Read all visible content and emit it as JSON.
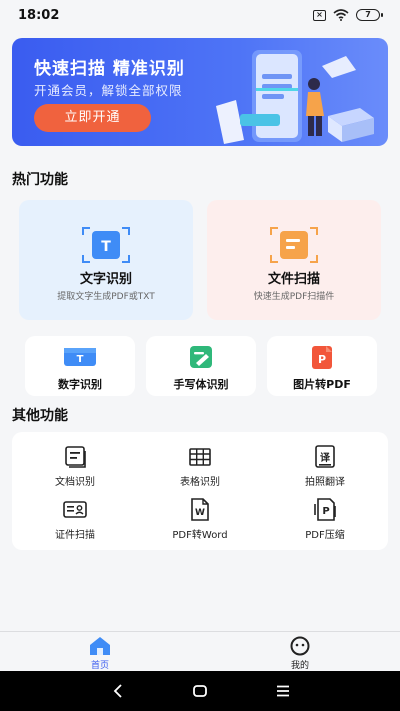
{
  "status_bar": {
    "time": "18:02",
    "battery": "7"
  },
  "banner": {
    "title": "快速扫描  精准识别",
    "subtitle": "开通会员，解锁全部权限",
    "cta_label": "立即开通"
  },
  "hot_section": {
    "title": "热门功能",
    "big_cards": [
      {
        "title": "文字识别",
        "subtitle": "提取文字生成PDF或TXT",
        "icon": "text-recognition-icon",
        "bg": "#e6f1fd"
      },
      {
        "title": "文件扫描",
        "subtitle": "快速生成PDF扫描件",
        "icon": "document-scan-icon",
        "bg": "#fdeeed"
      }
    ],
    "small_cards": [
      {
        "label": "数字识别",
        "icon": "number-recognition-icon"
      },
      {
        "label": "手写体识别",
        "icon": "handwriting-icon"
      },
      {
        "label": "图片转PDF",
        "icon": "image-to-pdf-icon"
      }
    ]
  },
  "other_section": {
    "title": "其他功能",
    "items": [
      {
        "label": "文档识别",
        "icon": "document-icon"
      },
      {
        "label": "表格识别",
        "icon": "table-icon"
      },
      {
        "label": "拍照翻译",
        "icon": "translate-icon"
      },
      {
        "label": "证件扫描",
        "icon": "id-card-icon"
      },
      {
        "label": "PDF转Word",
        "icon": "pdf-to-word-icon"
      },
      {
        "label": "PDF压缩",
        "icon": "pdf-compress-icon"
      }
    ]
  },
  "tabbar": {
    "tabs": [
      {
        "label": "首页",
        "icon": "home-icon",
        "active": true
      },
      {
        "label": "我的",
        "icon": "profile-icon",
        "active": false
      }
    ]
  },
  "colors": {
    "accent": "#3b5cf0",
    "cta": "#f0623e",
    "icon_blue": "#3f8cf6",
    "icon_orange": "#f6a34a",
    "icon_green": "#2fb87a",
    "icon_red": "#f2563a"
  }
}
